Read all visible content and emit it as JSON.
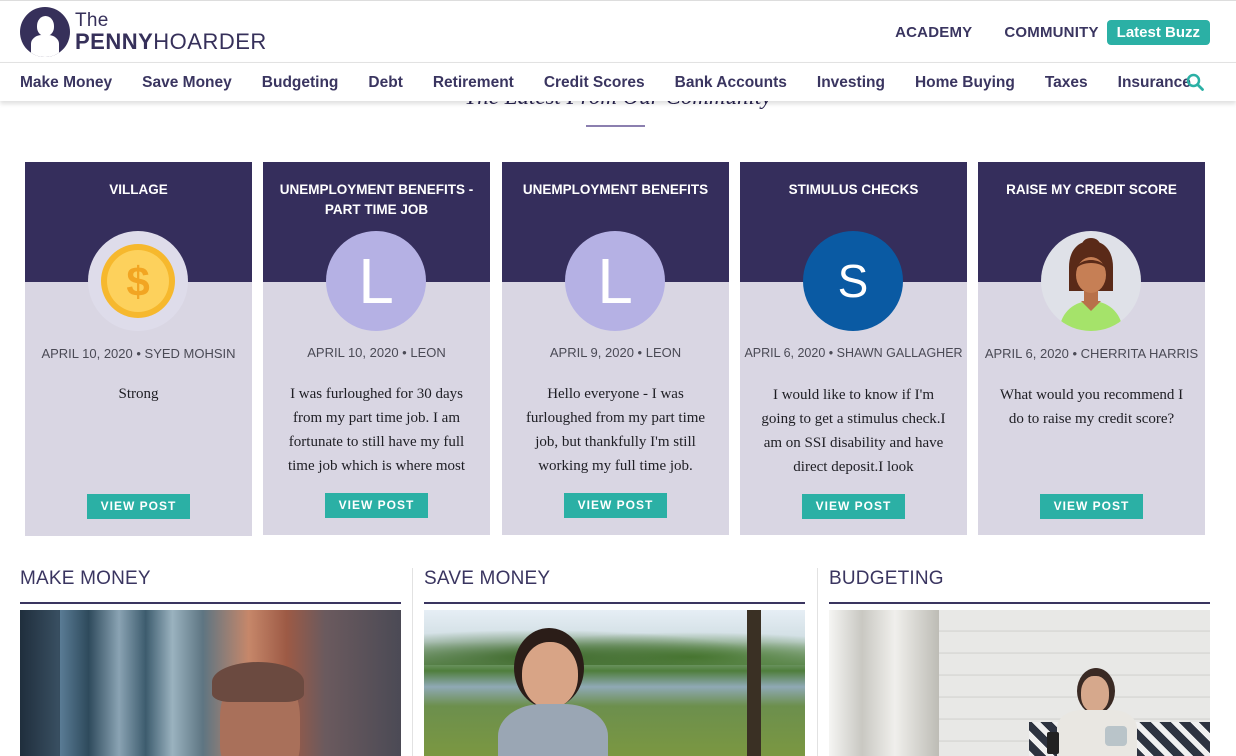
{
  "header": {
    "logo_the": "The",
    "logo_penny": "PENNY",
    "logo_hoarder": "HOARDER",
    "links": [
      "ACADEMY",
      "COMMUNITY"
    ],
    "buzz_label": "Latest Buzz",
    "accent": "#2bb0a5",
    "brand": "#36305a"
  },
  "nav": {
    "items": [
      "Make Money",
      "Save Money",
      "Budgeting",
      "Debt",
      "Retirement",
      "Credit Scores",
      "Bank Accounts",
      "Investing",
      "Home Buying",
      "Taxes",
      "Insurance"
    ],
    "search_icon": "search-icon"
  },
  "community": {
    "title": "The Latest From Our Community",
    "cards": [
      {
        "title": "VILLAGE",
        "avatar": "dollar-coin",
        "avatar_letter": "",
        "date": "APRIL 10, 2020",
        "author": "SYED MOHSIN",
        "text": "Strong",
        "button": "VIEW POST"
      },
      {
        "title": "UNEMPLOYMENT BENEFITS - PART TIME JOB",
        "avatar": "letter",
        "avatar_letter": "L",
        "date": "APRIL 10, 2020",
        "author": "LEON",
        "text": "I was furloughed for 30 days from my part time job. I am fortunate to still have my full time job which is where most",
        "button": "VIEW POST"
      },
      {
        "title": "UNEMPLOYMENT BENEFITS",
        "avatar": "letter",
        "avatar_letter": "L",
        "date": "APRIL 9, 2020",
        "author": "LEON",
        "text": "Hello everyone - I was furloughed from my part time job, but thankfully I'm still working my full time job.",
        "button": "VIEW POST"
      },
      {
        "title": "STIMULUS CHECKS",
        "avatar": "letter",
        "avatar_letter": "S",
        "date": "APRIL 6, 2020",
        "author": "SHAWN GALLAGHER",
        "text": "I would like to know if I'm going to get a stimulus check.I am on SSI disability and have direct deposit.I look",
        "button": "VIEW POST"
      },
      {
        "title": "RAISE MY CREDIT SCORE",
        "avatar": "woman-portrait",
        "avatar_letter": "",
        "date": "APRIL 6, 2020",
        "author": "CHERRITA HARRIS",
        "text": "What would you recommend I do to raise my credit score?",
        "button": "VIEW POST"
      }
    ]
  },
  "sections": [
    {
      "title": "MAKE MONEY",
      "image": "man-behind-window-photo"
    },
    {
      "title": "SAVE MONEY",
      "image": "child-in-park-photo"
    },
    {
      "title": "BUDGETING",
      "image": "woman-on-couch-photo"
    }
  ]
}
